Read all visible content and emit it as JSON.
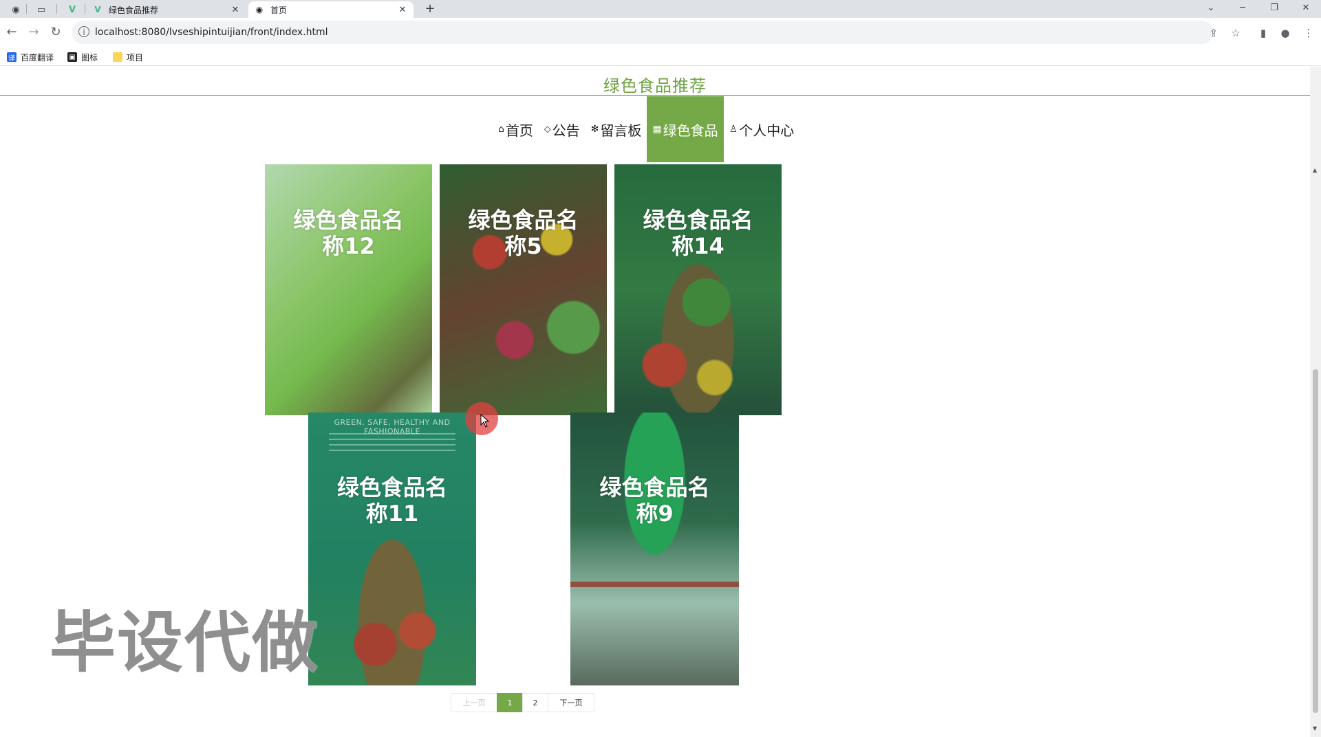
{
  "browser": {
    "tabs": [
      {
        "title": "绿色食品推荐",
        "active": false
      },
      {
        "title": "首页",
        "active": true
      }
    ],
    "url": "localhost:8080/lvseshipintuijian/front/index.html",
    "bookmarks": [
      "百度翻译",
      "图标",
      "项目"
    ],
    "icons": {
      "back": "←",
      "forward": "→",
      "reload": "↻",
      "info": "i",
      "share": "⇪",
      "star": "☆",
      "sidebar": "▮",
      "profile": "●",
      "menu": "⋮",
      "new_tab": "+",
      "close": "✕",
      "dropdown": "⌄",
      "minimize": "─",
      "restore": "❐",
      "window_close": "✕"
    }
  },
  "site": {
    "title": "绿色食品推荐",
    "accent_color": "#75a846"
  },
  "nav": [
    {
      "icon": "⌂",
      "label": "首页",
      "active": false
    },
    {
      "icon": "⌂",
      "label": "公告",
      "active": false
    },
    {
      "icon": "✻",
      "label": "留言板",
      "active": false
    },
    {
      "icon": "▦",
      "label": "绿色食品",
      "active": true
    },
    {
      "icon": "♙",
      "label": "个人中心",
      "active": false
    }
  ],
  "products": [
    {
      "name": "绿色食品名称12"
    },
    {
      "name": "绿色食品名称5"
    },
    {
      "name": "绿色食品名称14"
    },
    {
      "name": "绿色食品名称11",
      "tagline": "GREEN, SAFE, HEALTHY AND FASHIONABLE"
    },
    {
      "name": "绿色食品名称9"
    }
  ],
  "pagination": {
    "prev": "上一页",
    "pages": [
      "1",
      "2"
    ],
    "current": "1",
    "next": "下一页"
  },
  "watermark": "毕设代做"
}
